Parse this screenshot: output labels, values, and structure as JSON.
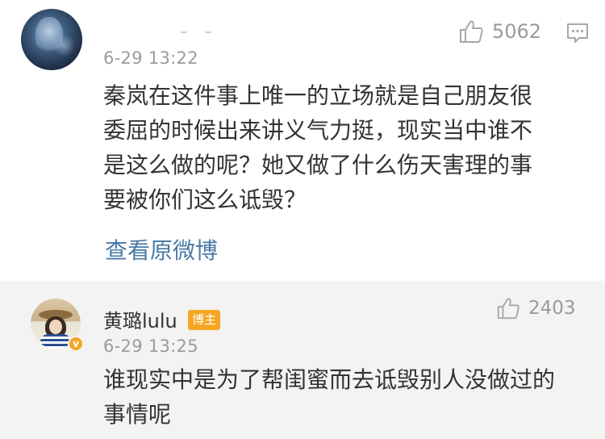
{
  "main_comment": {
    "timestamp": "6-29 13:22",
    "like_count": "5062",
    "text_lines": [
      "秦岚在这件事上唯一的立场就是自己朋友很",
      "委屈的时候出来讲义气力挺，现实当中谁不",
      "是这么做的呢？她又做了什么伤天害理的事",
      "要被你们这么诋毁？"
    ],
    "link_label": "查看原微博",
    "icons": {
      "like": "thumbs-up-icon",
      "comment": "comment-icon"
    }
  },
  "reply": {
    "username": "黄璐lulu",
    "badge_label": "博主",
    "timestamp": "6-29 13:25",
    "like_count": "2403",
    "text_lines": [
      "谁现实中是为了帮闺蜜而去诋毁别人没做过的",
      "事情呢"
    ],
    "icons": {
      "like": "thumbs-up-icon",
      "verified": "verified-badge-icon"
    }
  },
  "colors": {
    "link": "#4a7aa8",
    "meta_gray": "#9b9b9b",
    "reply_background": "#f3f3f3",
    "badge_orange": "#f5a623"
  }
}
